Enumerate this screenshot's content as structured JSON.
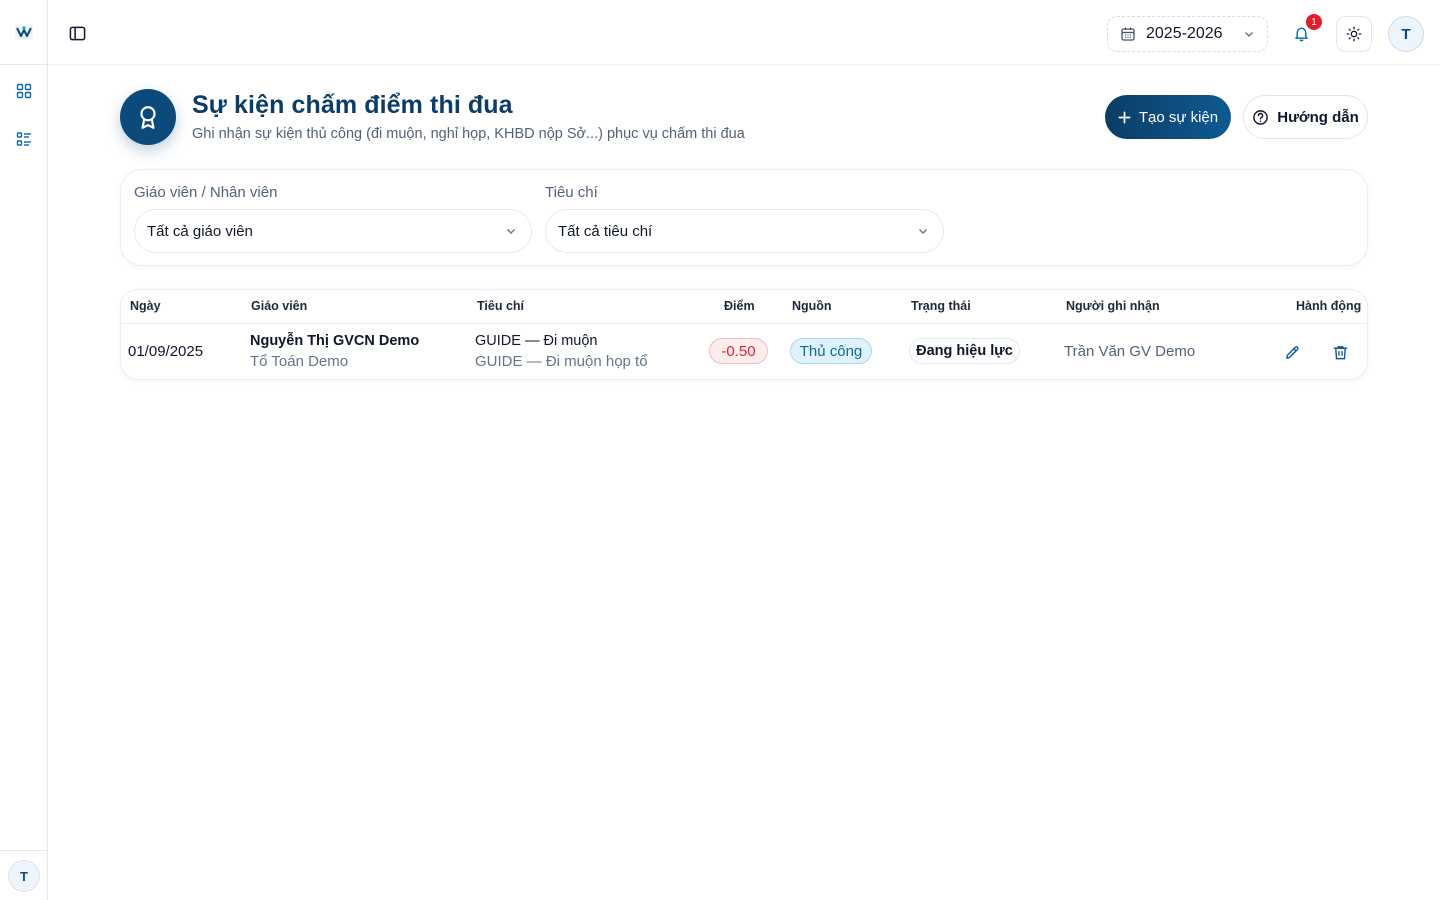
{
  "sidebar": {
    "logo_icon": "app-logo-icon",
    "items": [
      {
        "icon": "dashboard-grid-icon"
      },
      {
        "icon": "list-checks-icon"
      }
    ],
    "avatar_initial": "T"
  },
  "topbar": {
    "toggle_icon": "sidebar-toggle-icon",
    "year": {
      "value": "2025-2026",
      "icon": "calendar-icon"
    },
    "notifications": {
      "count": "1",
      "icon": "bell-icon"
    },
    "theme_icon": "sun-icon",
    "avatar_initial": "T"
  },
  "header": {
    "icon": "award-ribbon-icon",
    "title": "Sự kiện chấm điểm thi đua",
    "subtitle": "Ghi nhận sự kiện thủ công (đi muộn, nghỉ họp, KHBD nộp Sở...) phục vụ chấm thi đua",
    "create_label": "Tạo sự kiện",
    "guide_label": "Hướng dẫn"
  },
  "filters": {
    "teacher": {
      "label": "Giáo viên / Nhân viên",
      "value": "Tất cả giáo viên"
    },
    "criteria": {
      "label": "Tiêu chí",
      "value": "Tất cả tiêu chí"
    }
  },
  "table": {
    "headers": {
      "date": "Ngày",
      "teacher": "Giáo viên",
      "criteria": "Tiêu chí",
      "score": "Điểm",
      "source": "Nguồn",
      "status": "Trạng thái",
      "recorder": "Người ghi nhận",
      "actions": "Hành động"
    },
    "rows": [
      {
        "date": "01/09/2025",
        "teacher_name": "Nguyễn Thị GVCN Demo",
        "teacher_group": "Tổ Toán Demo",
        "criteria_main": "GUIDE — Đi muộn",
        "criteria_sub": "GUIDE — Đi muộn họp tổ",
        "score": "-0.50",
        "source": "Thủ công",
        "status": "Đang hiệu lực",
        "recorder": "Trần Văn GV Demo"
      }
    ]
  },
  "colors": {
    "primary": "#0b4a7a",
    "danger": "#e11d2e",
    "source_bg": "#dff2fb",
    "source_text": "#0b6a96"
  }
}
